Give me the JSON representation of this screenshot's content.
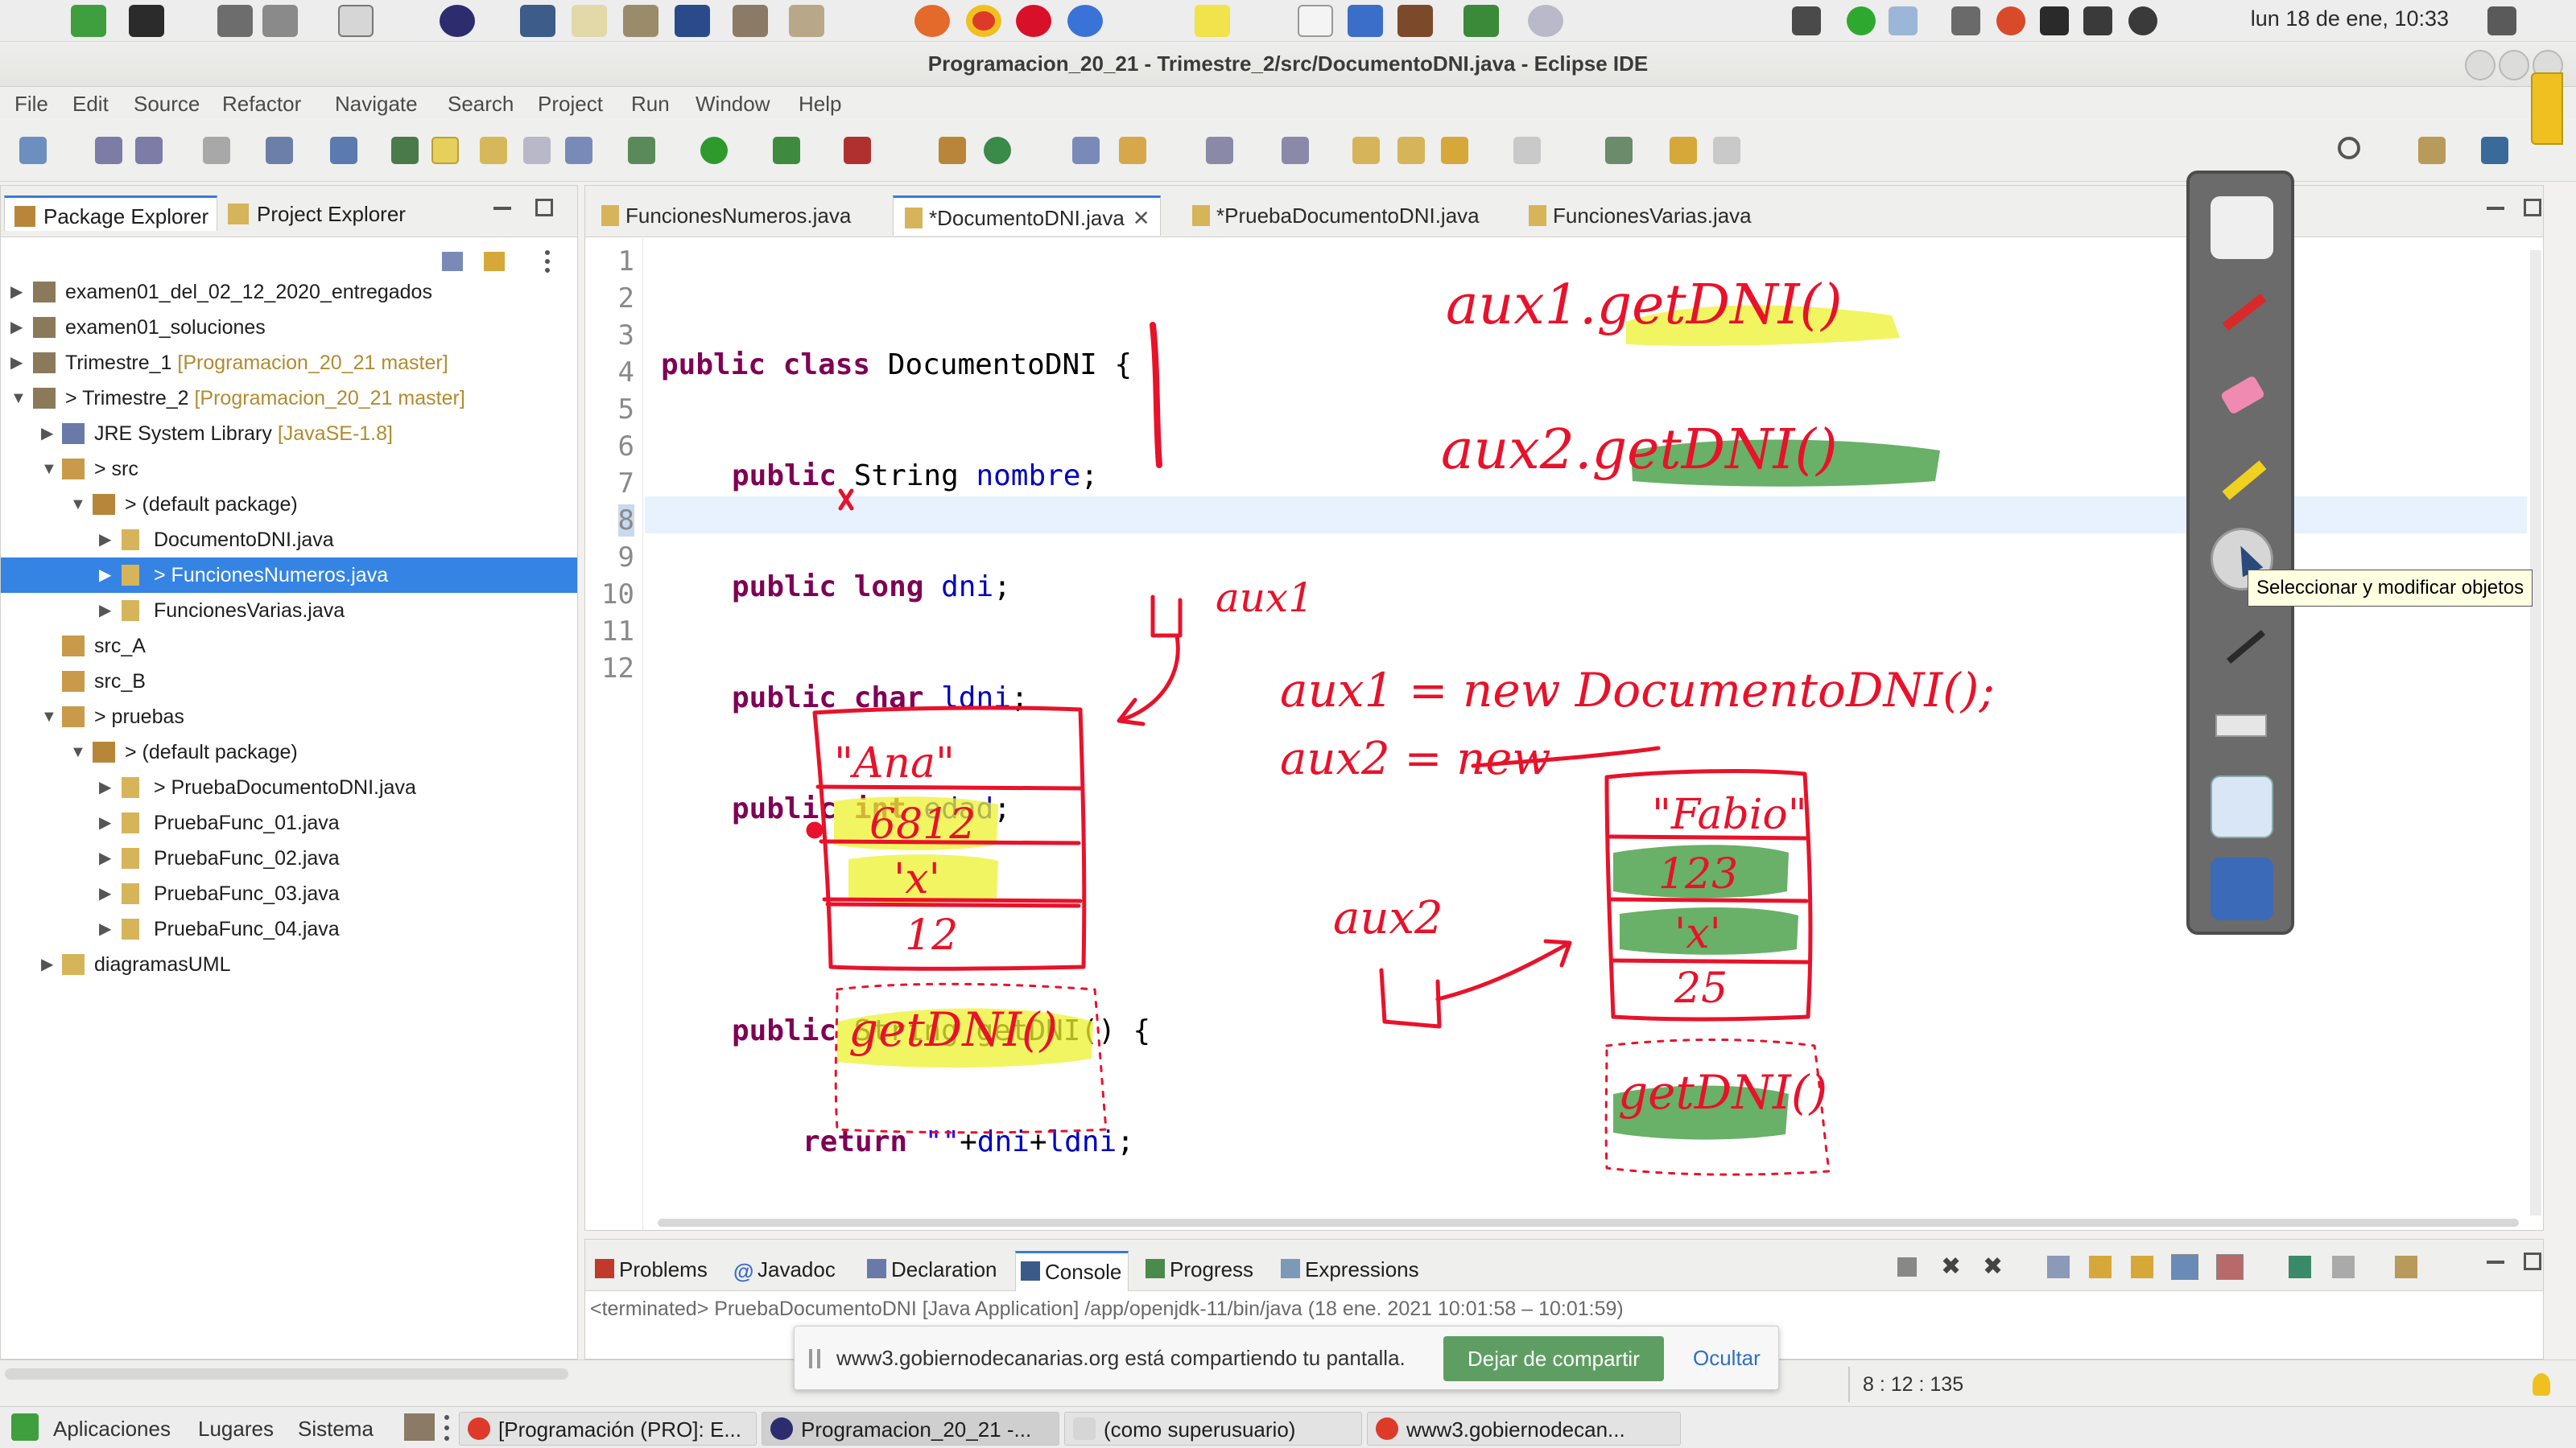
{
  "system_panel": {
    "clock": "lun 18 de ene, 10:33"
  },
  "window": {
    "title": "Programacion_20_21 - Trimestre_2/src/DocumentoDNI.java - Eclipse IDE"
  },
  "menu": [
    "File",
    "Edit",
    "Source",
    "Refactor",
    "Navigate",
    "Search",
    "Project",
    "Run",
    "Window",
    "Help"
  ],
  "explorer": {
    "tabs": [
      "Package Explorer",
      "Project Explorer"
    ],
    "tree": [
      {
        "label": "examen01_del_02_12_2020_entregados",
        "suffix": ""
      },
      {
        "label": "examen01_soluciones",
        "suffix": ""
      },
      {
        "label": "Trimestre_1",
        "suffix": "[Programacion_20_21 master]"
      },
      {
        "label": "> Trimestre_2",
        "suffix": "[Programacion_20_21 master]"
      },
      {
        "label": "JRE System Library",
        "suffix": "[JavaSE-1.8]"
      },
      {
        "label": "> src",
        "suffix": ""
      },
      {
        "label": "> (default package)",
        "suffix": ""
      },
      {
        "label": "DocumentoDNI.java",
        "suffix": ""
      },
      {
        "label": "> FuncionesNumeros.java",
        "suffix": ""
      },
      {
        "label": "FuncionesVarias.java",
        "suffix": ""
      },
      {
        "label": "src_A",
        "suffix": ""
      },
      {
        "label": "src_B",
        "suffix": ""
      },
      {
        "label": "> pruebas",
        "suffix": ""
      },
      {
        "label": "> (default package)",
        "suffix": ""
      },
      {
        "label": "> PruebaDocumentoDNI.java",
        "suffix": ""
      },
      {
        "label": "PruebaFunc_01.java",
        "suffix": ""
      },
      {
        "label": "PruebaFunc_02.java",
        "suffix": ""
      },
      {
        "label": "PruebaFunc_03.java",
        "suffix": ""
      },
      {
        "label": "PruebaFunc_04.java",
        "suffix": ""
      },
      {
        "label": "diagramasUML",
        "suffix": ""
      }
    ]
  },
  "editor": {
    "tabs": [
      "FuncionesNumeros.java",
      "*DocumentoDNI.java",
      "*PruebaDocumentoDNI.java",
      "FuncionesVarias.java"
    ],
    "line_numbers": [
      "1",
      "2",
      "3",
      "4",
      "5",
      "6",
      "7",
      "8",
      "9",
      "10",
      "11",
      "12"
    ],
    "code": {
      "l2a": "public class",
      "l2b": " DocumentoDNI {",
      "l3a": "public",
      "l3b": " String ",
      "l3c": "nombre",
      "l3d": ";",
      "l4a": "public long",
      "l4c": " dni",
      "l4d": ";",
      "l5a": "public char",
      "l5c": " ldni",
      "l5d": ";",
      "l6a": "public int",
      "l6c": " edad",
      "l6d": ";",
      "l8a": "public",
      "l8b": " String getDNI() {",
      "l9a": "return",
      "l9b": " ",
      "l9s": "\"\"",
      "l9c": "+",
      "l9d": "dni",
      "l9e": "+",
      "l9f": "ldni",
      "l9g": ";",
      "l10": "}",
      "l11": "}"
    }
  },
  "handwriting": {
    "aux1_call": "aux1.getDNI()",
    "aux2_call": "aux2.getDNI()",
    "aux1_label": "aux1",
    "aux1_assign": "aux1 = new DocumentoDNI();",
    "aux2_assign": "aux2 = new",
    "aux2_label": "aux2",
    "obj1": [
      "\"Ana\"",
      "6812",
      "'x'",
      "12",
      "getDNI()"
    ],
    "obj2": [
      "\"Fabio\"",
      "123",
      "'x'",
      "25",
      "getDNI()"
    ]
  },
  "smart_toolbar": {
    "tooltip": "Seleccionar y modificar objetos"
  },
  "bottom_panel": {
    "tabs": [
      "Problems",
      "Javadoc",
      "Declaration",
      "Console",
      "Progress",
      "Expressions"
    ],
    "console_header": "<terminated> PruebaDocumentoDNI [Java Application] /app/openjdk-11/bin/java  (18 ene. 2021 10:01:58 – 10:01:59)"
  },
  "share_banner": {
    "message": "www3.gobiernodecanarias.org está compartiendo tu pantalla.",
    "stop": "Dejar de compartir",
    "hide": "Ocultar"
  },
  "status_bar": {
    "position": "8 : 12 : 135"
  },
  "taskbar": {
    "menus": [
      "Aplicaciones",
      "Lugares",
      "Sistema"
    ],
    "items": [
      "[Programación (PRO]: E...",
      "Programacion_20_21 -...",
      "(como superusuario)",
      "www3.gobiernodecan..."
    ]
  },
  "colors": {
    "selection": "#3584e4",
    "ink_red": "#e8122a",
    "highlight_yellow": "#eef22e",
    "highlight_green": "#4fa24d"
  }
}
